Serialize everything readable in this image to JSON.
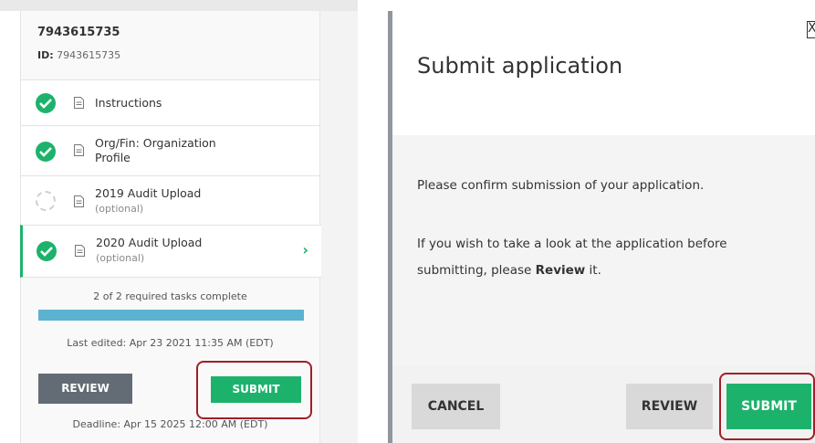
{
  "left_panel": {
    "title": "7943615735",
    "id_label": "ID:",
    "id_value": "7943615735",
    "tasks": [
      {
        "label": "Instructions",
        "sub": "",
        "status": "complete"
      },
      {
        "label": "Org/Fin: Organization",
        "label2": "Profile",
        "sub": "",
        "status": "complete"
      },
      {
        "label": "2019 Audit Upload",
        "sub": "(optional)",
        "status": "incomplete"
      },
      {
        "label": "2020 Audit Upload",
        "sub": "(optional)",
        "status": "complete",
        "active": true
      }
    ],
    "progress_text": "2 of 2 required tasks complete",
    "progress_fraction": 1.0,
    "last_edited": "Last edited: Apr 23 2021 11:35 AM (EDT)",
    "review_label": "REVIEW",
    "submit_label": "SUBMIT",
    "deadline": "Deadline: Apr 15 2025 12:00 AM (EDT)"
  },
  "modal": {
    "title": "Submit application",
    "body_line1": "Please confirm submission of your application.",
    "body_line2_prefix": "If you wish to take a look at the application before submitting, please ",
    "body_line2_bold": "Review",
    "body_line2_suffix": " it.",
    "cancel_label": "CANCEL",
    "review_label": "REVIEW",
    "submit_label": "SUBMIT"
  },
  "colors": {
    "accent_green": "#1db26b",
    "progress_blue": "#5bb3d1",
    "highlight_red": "#a11f27",
    "review_dark": "#636b74"
  },
  "icons": [
    "check-circle-icon",
    "document-icon",
    "chevron-right-icon",
    "close-icon"
  ]
}
